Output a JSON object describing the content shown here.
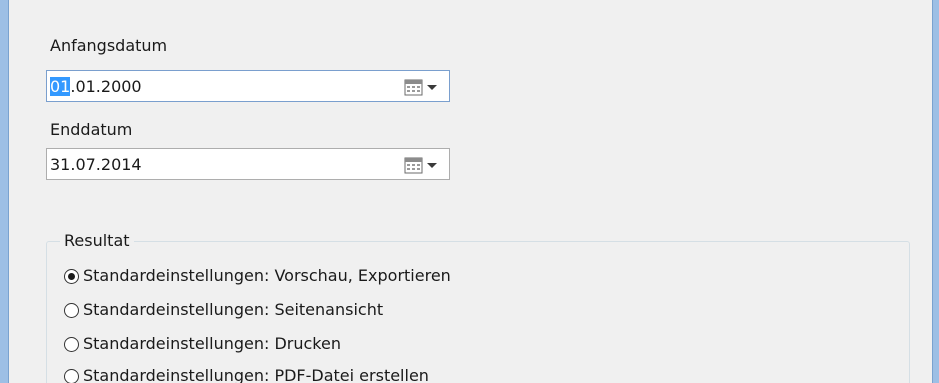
{
  "form": {
    "start_date": {
      "label": "Anfangsdatum",
      "value_selected_part": "01",
      "value_rest": ".01.2000",
      "picker_icon": "calendar-dropdown-icon"
    },
    "end_date": {
      "label": "Enddatum",
      "value": "31.07.2014",
      "picker_icon": "calendar-dropdown-icon"
    }
  },
  "result": {
    "title": "Resultat",
    "options": [
      {
        "label": "Standardeinstellungen: Vorschau, Exportieren",
        "checked": true
      },
      {
        "label": "Standardeinstellungen: Seitenansicht",
        "checked": false
      },
      {
        "label": "Standardeinstellungen: Drucken",
        "checked": false
      },
      {
        "label": "Standardeinstellungen: PDF-Datei erstellen",
        "checked": false
      }
    ]
  },
  "colors": {
    "selection": "#3399ff",
    "window_border": "#9dbfe5",
    "panel_background": "#f0f0f0"
  }
}
